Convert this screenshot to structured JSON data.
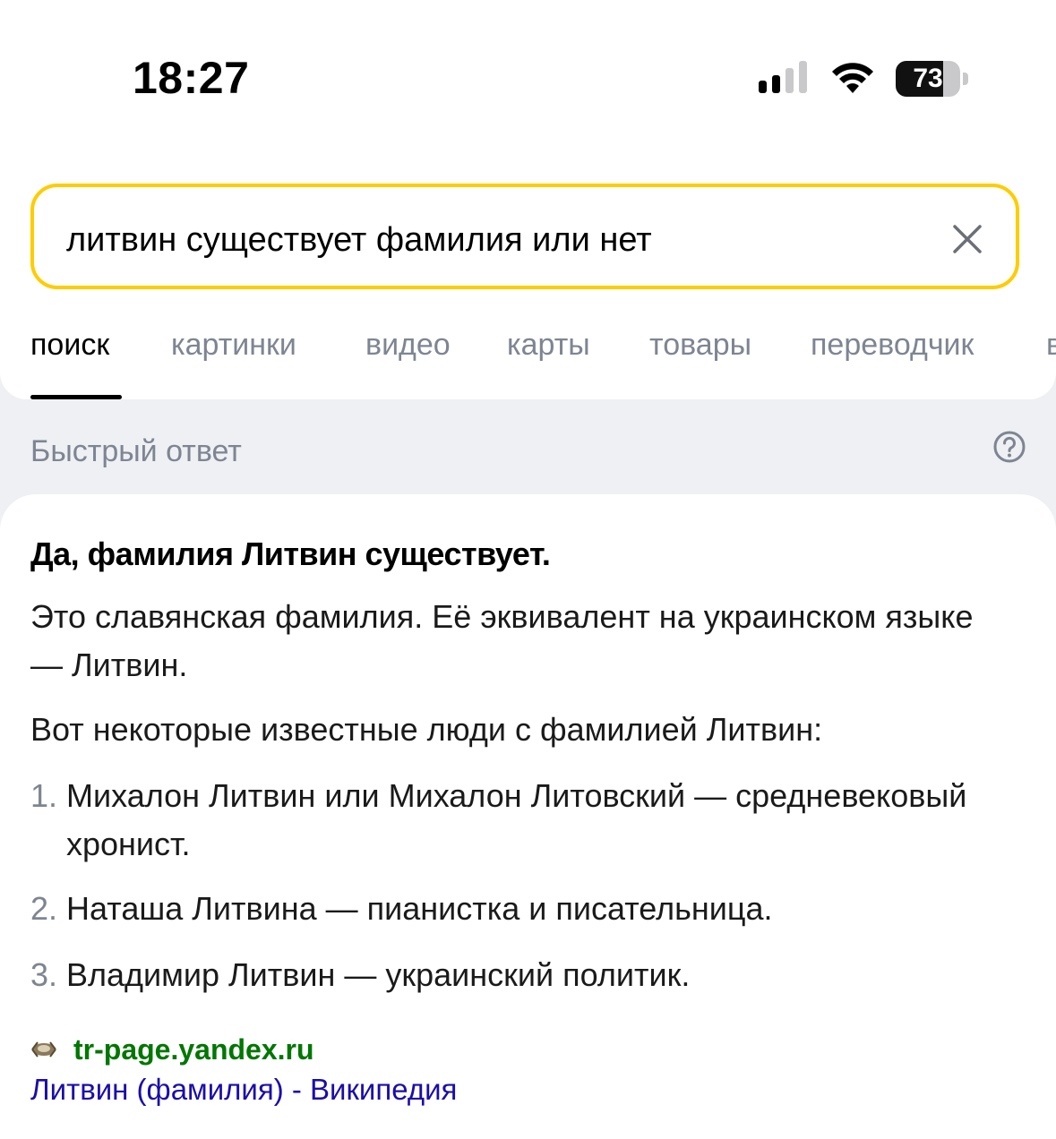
{
  "status_bar": {
    "time": "18:27",
    "battery_level": "73",
    "battery_fraction": 0.73,
    "icons": [
      "cellular-signal-icon",
      "wifi-icon",
      "battery-icon"
    ]
  },
  "search": {
    "query": "литвин существует фамилия или нет",
    "clear_icon": "close-icon",
    "accent_color": "#ffcc00"
  },
  "tabs": [
    {
      "label": "поиск",
      "active": true
    },
    {
      "label": "картинки",
      "active": false
    },
    {
      "label": "видео",
      "active": false
    },
    {
      "label": "карты",
      "active": false
    },
    {
      "label": "товары",
      "active": false
    },
    {
      "label": "переводчик",
      "active": false
    },
    {
      "label": "в",
      "active": false
    }
  ],
  "quick_answer": {
    "header": "Быстрый ответ",
    "help_icon": "question-circle-icon",
    "title": "Да, фамилия Литвин существует.",
    "paragraph1": "Это славянская фамилия. Её эквивалент на украинском языке — Литвин.",
    "paragraph2": "Вот некоторые известные люди с фамилией Литвин:",
    "list": [
      {
        "num": "1.",
        "text": "Михалон Литвин или Михалон Литовский — средневековый хронист."
      },
      {
        "num": "2.",
        "text": "Наташа Литвина — пианистка и писательница."
      },
      {
        "num": "3.",
        "text": "Владимир Литвин — украинский политик."
      }
    ],
    "source": {
      "domain": "tr-page.yandex.ru",
      "link_text": "Литвин (фамилия) - Википедия",
      "domain_color": "#007700",
      "link_color": "#1a0dab"
    }
  }
}
